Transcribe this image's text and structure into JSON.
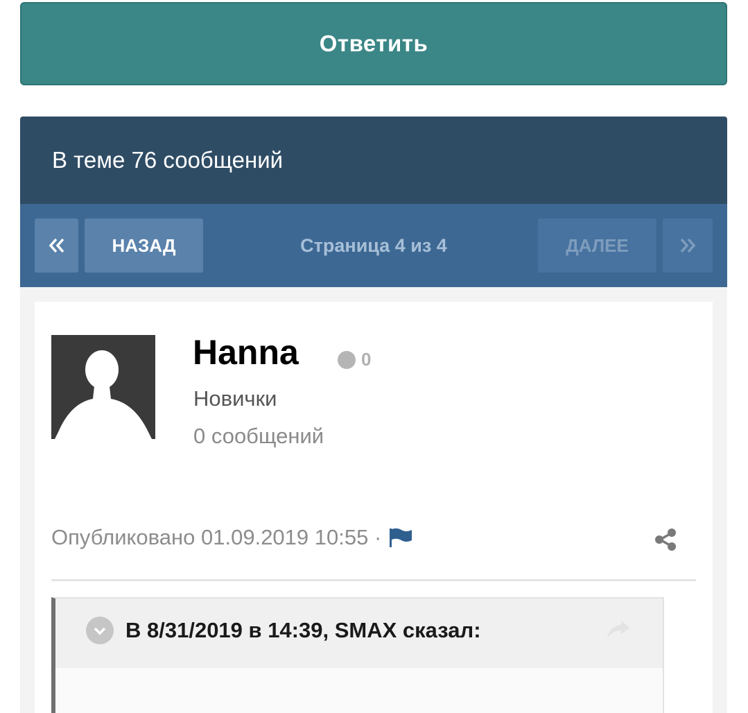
{
  "reply_button": {
    "label": "Ответить"
  },
  "topic": {
    "header": "В теме 76 сообщений",
    "pagination": {
      "prev_label": "НАЗАД",
      "next_label": "ДАЛЕЕ",
      "page_info": "Страница 4 из 4",
      "first_icon": "double-chevron-left-icon",
      "last_icon": "double-chevron-right-icon"
    }
  },
  "post": {
    "author": "Hanna",
    "reputation": "0",
    "group": "Новички",
    "post_count": "0 сообщений",
    "published": "Опубликовано 01.09.2019 10:55 ·",
    "icons": {
      "avatar": "default-avatar-icon",
      "report": "flag-icon",
      "share": "share-icon"
    },
    "quote": {
      "title": "В 8/31/2019 в 14:39, SMAX сказал:",
      "toggle_icon": "chevron-down-icon",
      "link_icon": "reply-arrow-icon"
    }
  },
  "colors": {
    "reply_button": "#3b8686",
    "topic_header": "#2f4c65",
    "pager": "#3d6893",
    "flag": "#2f5f8f"
  }
}
